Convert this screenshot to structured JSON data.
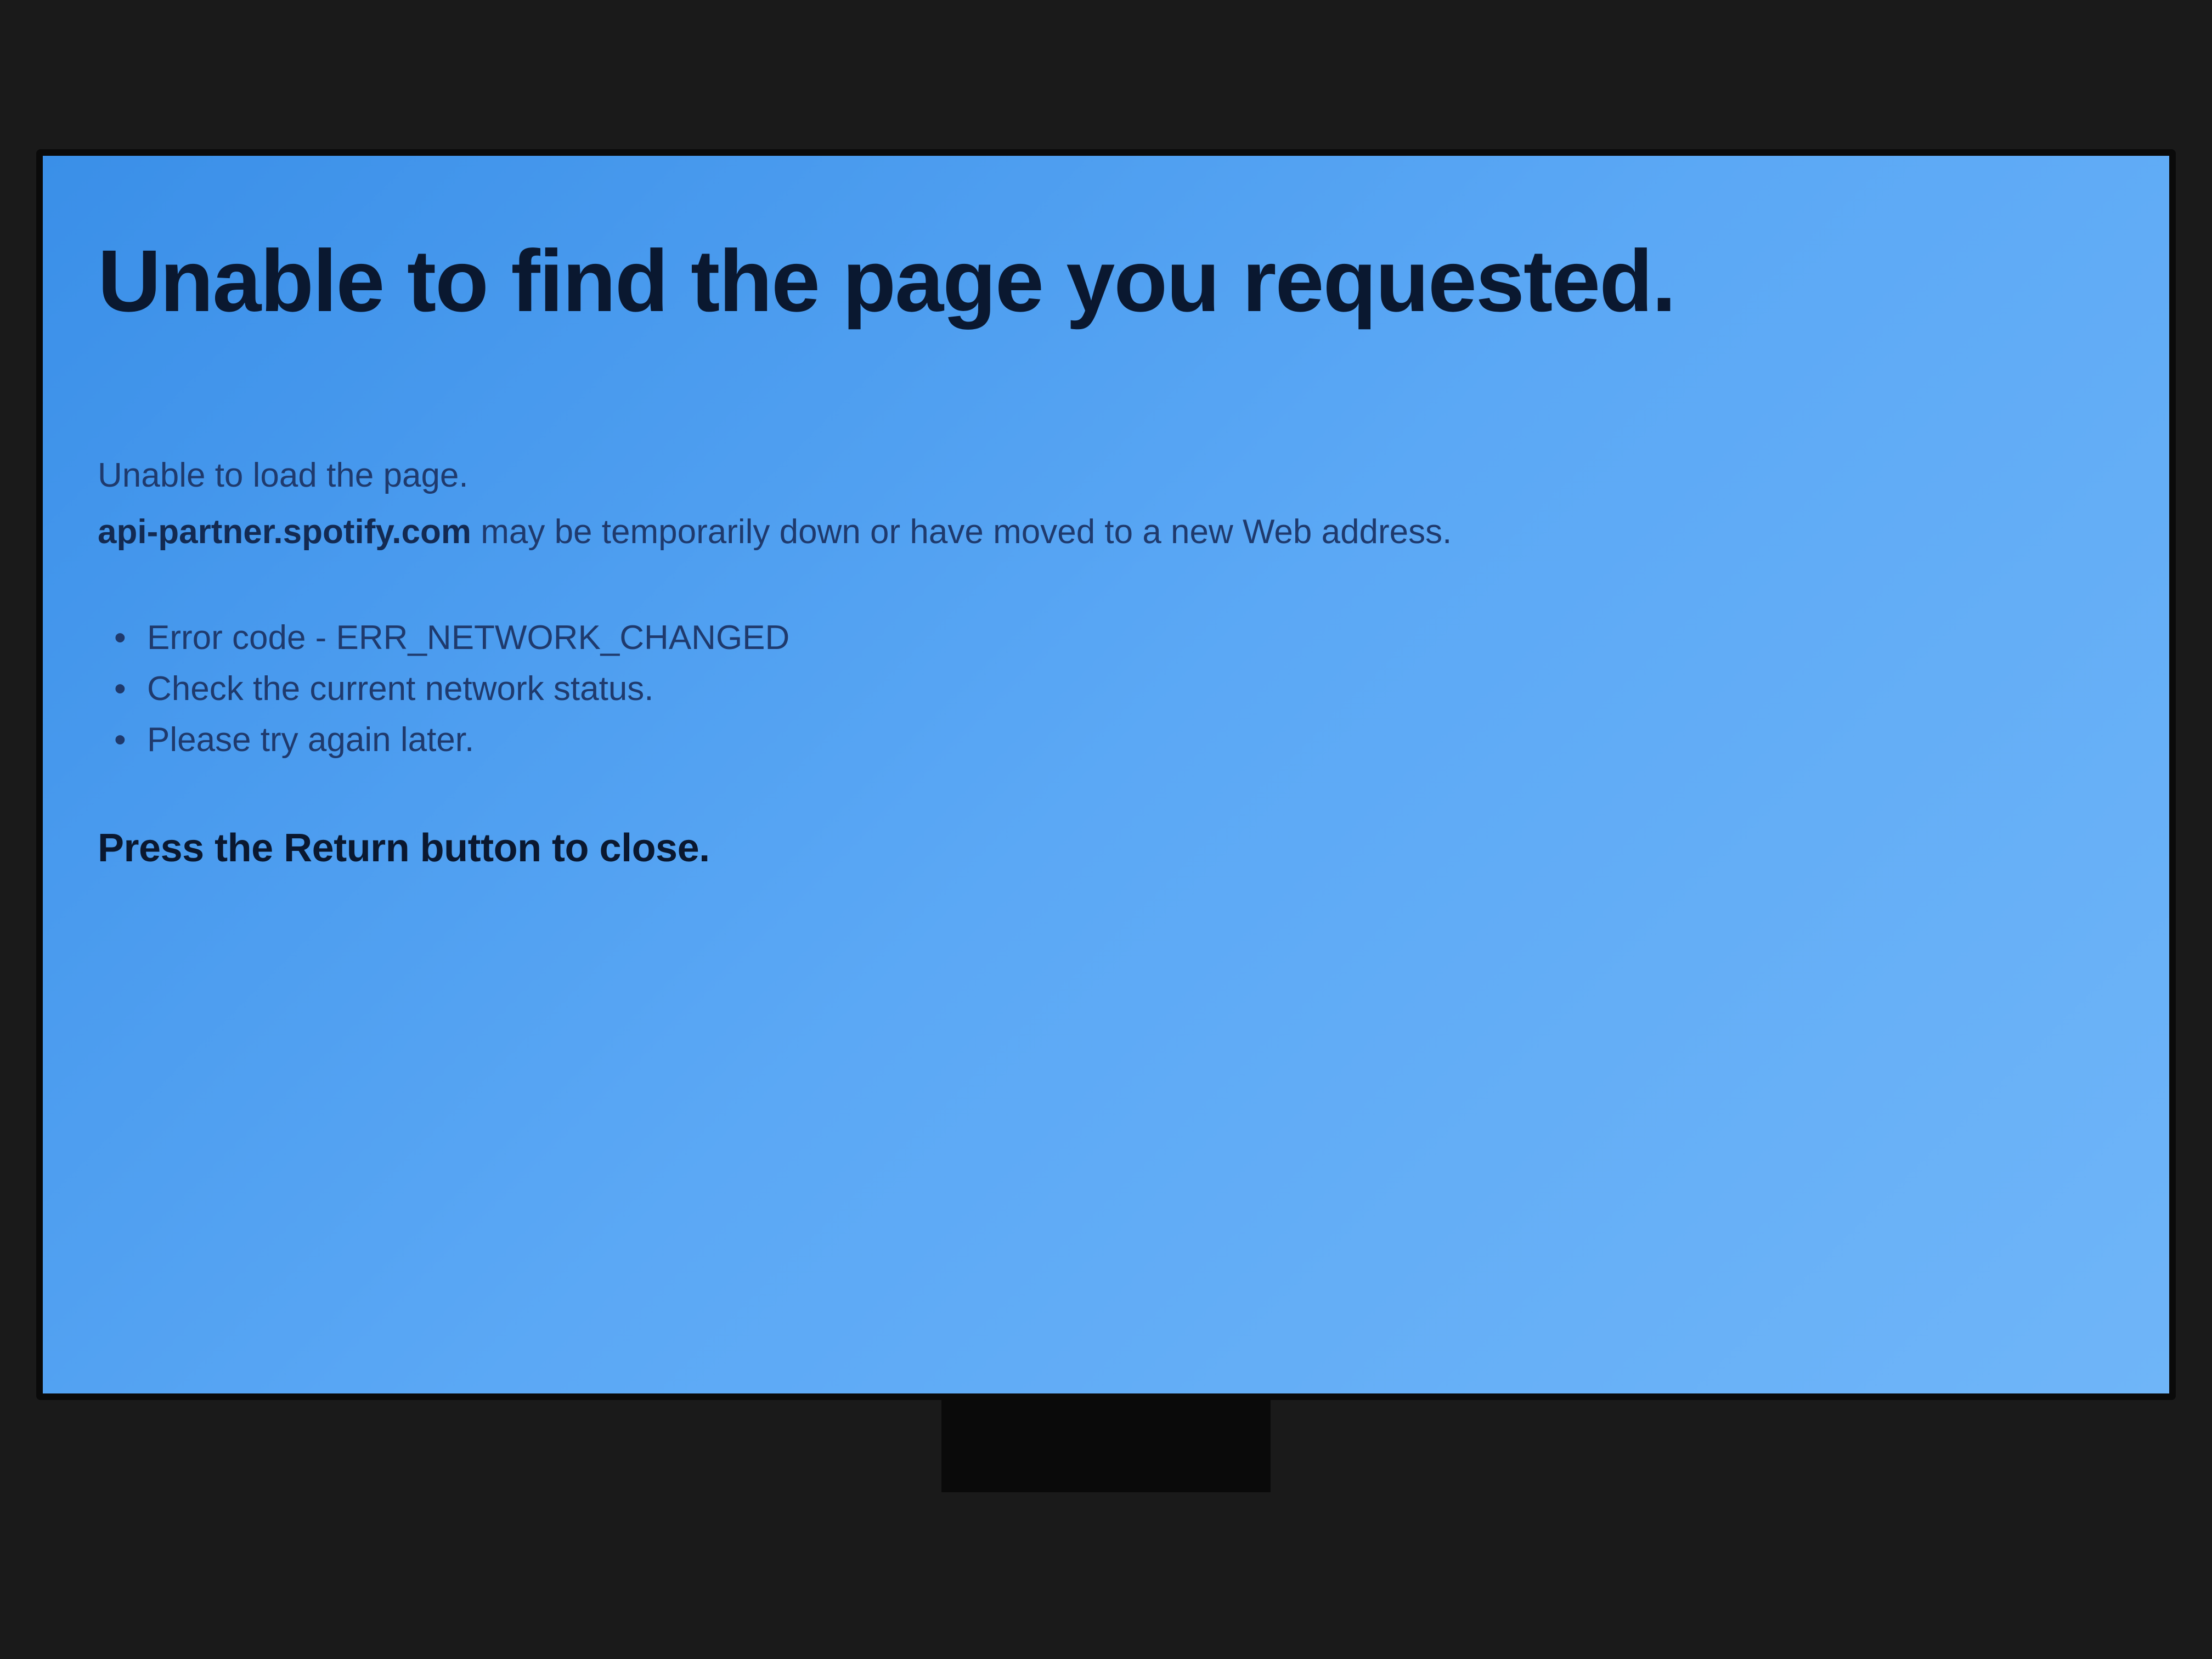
{
  "error": {
    "title": "Unable to find the page you requested.",
    "subtitle": "Unable to load the page.",
    "hostname": "api-partner.spotify.com",
    "hostname_suffix": " may be temporarily down or have moved to a new Web address.",
    "bullets": [
      "Error code - ERR_NETWORK_CHANGED",
      "Check the current network status.",
      "Please try again later."
    ],
    "close_instruction": "Press the Return button to close."
  }
}
